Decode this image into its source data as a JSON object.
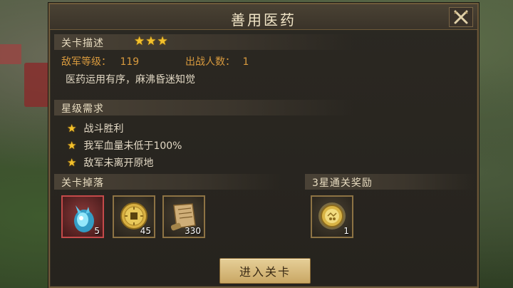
{
  "dialog": {
    "title": "善用医药",
    "close_icon": "close-x-icon"
  },
  "stage": {
    "section_label": "关卡描述",
    "stars": 3,
    "star_glyphs": "★★★",
    "enemy_level_label": "敌军等级：",
    "enemy_level_value": "119",
    "troops_label": "出战人数：",
    "troops_value": "1",
    "description": "医药运用有序，麻沸昏迷知觉"
  },
  "requirements": {
    "section_label": "星级需求",
    "items": [
      {
        "text": "战斗胜利",
        "icon": "star-icon"
      },
      {
        "text": "我军血量未低于100%",
        "icon": "star-icon"
      },
      {
        "text": "敌军未离开原地",
        "icon": "star-icon"
      }
    ]
  },
  "drops": {
    "section_label": "关卡掉落",
    "items": [
      {
        "icon": "blue-crystal-icon",
        "count": "5",
        "rarity": "red"
      },
      {
        "icon": "gold-coin-icon",
        "count": "45",
        "rarity": "normal"
      },
      {
        "icon": "scroll-icon",
        "count": "330",
        "rarity": "normal"
      }
    ]
  },
  "rewards": {
    "section_label": "3星通关奖励",
    "items": [
      {
        "icon": "gold-medal-icon",
        "count": "1"
      }
    ]
  },
  "actions": {
    "enter_label": "进入关卡"
  },
  "colors": {
    "accent_gold": "#f3c12c",
    "label_orange": "#d89a3e",
    "panel_bg": "#26231e",
    "border": "#6e5a3a"
  }
}
